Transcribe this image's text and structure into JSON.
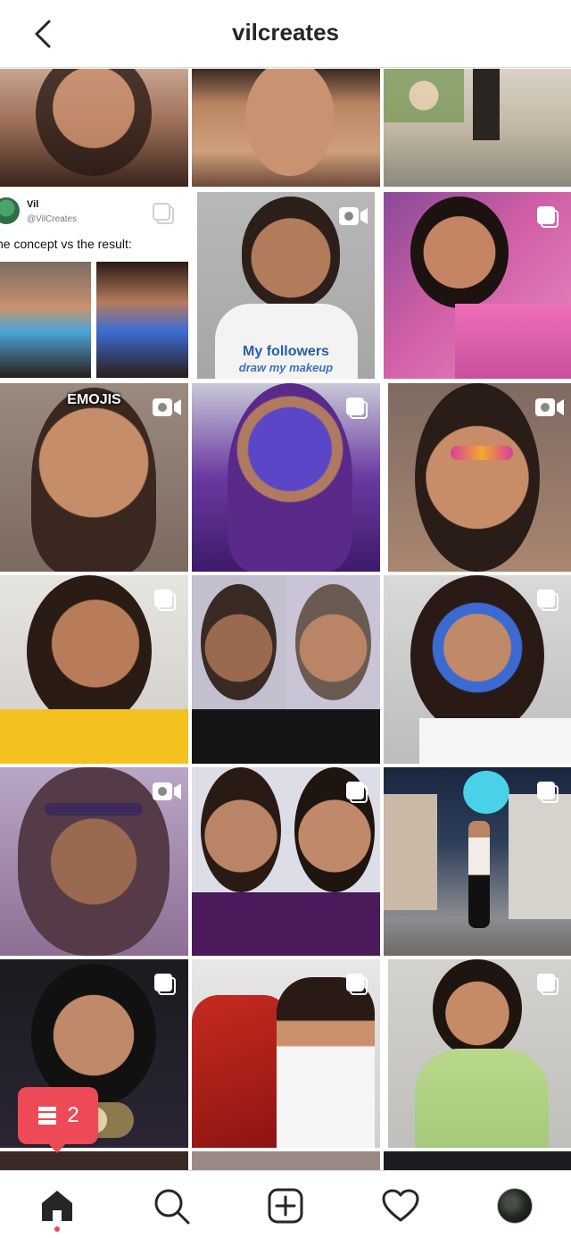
{
  "header": {
    "title": "vilcreates",
    "back_icon": "chevron-left-icon"
  },
  "colors": {
    "accent_red": "#ed4956",
    "border": "#dbdbdb",
    "text": "#262626"
  },
  "grid": {
    "tweet": {
      "name": "Vil",
      "handle": "@VilCreates",
      "text": "he concept vs the result:"
    },
    "tiles": [
      {
        "id": "row1-col1",
        "type": "photo"
      },
      {
        "id": "row1-col2",
        "type": "photo"
      },
      {
        "id": "row1-col3",
        "type": "photo"
      },
      {
        "id": "row2-col1",
        "type": "tweet-screenshot",
        "indicator": "multiple-posts-icon"
      },
      {
        "id": "row2-col2",
        "type": "video",
        "indicator": "video-camera-icon",
        "caption_line1": "My followers",
        "caption_line2": "draw my makeup"
      },
      {
        "id": "row2-col3",
        "type": "carousel",
        "indicator": "multiple-posts-icon"
      },
      {
        "id": "row3-col1",
        "type": "video",
        "indicator": "video-camera-icon",
        "caption": "EMOJIS"
      },
      {
        "id": "row3-col2",
        "type": "carousel",
        "indicator": "multiple-posts-icon"
      },
      {
        "id": "row3-col3",
        "type": "video",
        "indicator": "video-camera-icon"
      },
      {
        "id": "row4-col1",
        "type": "carousel",
        "indicator": "multiple-posts-icon"
      },
      {
        "id": "row4-col2",
        "type": "photo"
      },
      {
        "id": "row4-col3",
        "type": "carousel",
        "indicator": "multiple-posts-icon"
      },
      {
        "id": "row5-col1",
        "type": "video",
        "indicator": "video-camera-icon"
      },
      {
        "id": "row5-col2",
        "type": "carousel",
        "indicator": "multiple-posts-icon"
      },
      {
        "id": "row5-col3",
        "type": "carousel",
        "indicator": "multiple-posts-icon"
      },
      {
        "id": "row6-col1",
        "type": "carousel",
        "indicator": "multiple-posts-icon"
      },
      {
        "id": "row6-col2",
        "type": "carousel",
        "indicator": "multiple-posts-icon"
      },
      {
        "id": "row6-col3",
        "type": "carousel",
        "indicator": "multiple-posts-icon"
      }
    ]
  },
  "notification": {
    "count": "2",
    "icon": "posts-stack-icon"
  },
  "bottom_nav": {
    "items": [
      {
        "name": "home",
        "icon": "home-icon",
        "active": true
      },
      {
        "name": "search",
        "icon": "search-icon"
      },
      {
        "name": "new-post",
        "icon": "add-post-icon"
      },
      {
        "name": "activity",
        "icon": "heart-icon"
      },
      {
        "name": "profile",
        "icon": "profile-avatar"
      }
    ]
  }
}
